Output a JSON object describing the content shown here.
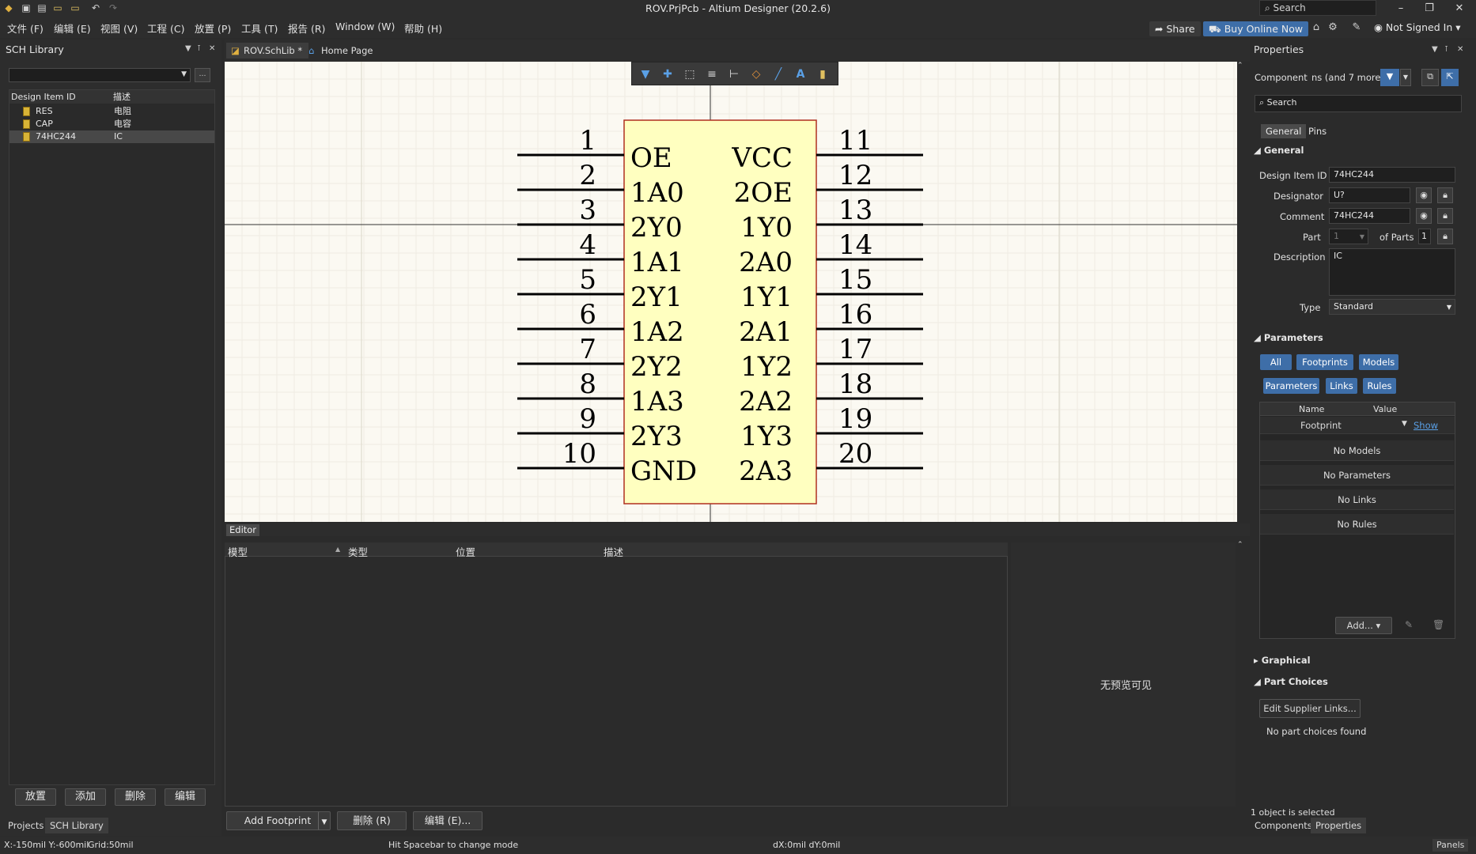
{
  "window": {
    "title": "ROV.PrjPcb - Altium Designer (20.2.6)",
    "search_placeholder": "Search",
    "share": "Share",
    "buy": "Buy Online Now",
    "user": "Not Signed In"
  },
  "menu": [
    "文件 (F)",
    "编辑 (E)",
    "视图 (V)",
    "工程 (C)",
    "放置 (P)",
    "工具 (T)",
    "报告 (R)",
    "Window (W)",
    "帮助 (H)"
  ],
  "left_panel": {
    "title": "SCH Library",
    "columns": [
      "Design Item ID",
      "描述"
    ],
    "rows": [
      {
        "id": "RES",
        "desc": "电阻"
      },
      {
        "id": "CAP",
        "desc": "电容"
      },
      {
        "id": "74HC244",
        "desc": "IC"
      }
    ],
    "buttons": [
      "放置",
      "添加",
      "删除",
      "编辑"
    ],
    "tabs": [
      "Projects",
      "SCH Library"
    ]
  },
  "doc_tabs": [
    "ROV.SchLib *",
    "Home Page"
  ],
  "component": {
    "left_pins": [
      {
        "num": "1",
        "name": "OE"
      },
      {
        "num": "2",
        "name": "1A0"
      },
      {
        "num": "3",
        "name": "2Y0"
      },
      {
        "num": "4",
        "name": "1A1"
      },
      {
        "num": "5",
        "name": "2Y1"
      },
      {
        "num": "6",
        "name": "1A2"
      },
      {
        "num": "7",
        "name": "2Y2"
      },
      {
        "num": "8",
        "name": "1A3"
      },
      {
        "num": "9",
        "name": "2Y3"
      },
      {
        "num": "10",
        "name": "GND"
      }
    ],
    "right_pins": [
      {
        "num": "11",
        "name": "VCC"
      },
      {
        "num": "12",
        "name": "2OE"
      },
      {
        "num": "13",
        "name": "1Y0"
      },
      {
        "num": "14",
        "name": "2A0"
      },
      {
        "num": "15",
        "name": "1Y1"
      },
      {
        "num": "16",
        "name": "2A1"
      },
      {
        "num": "17",
        "name": "1Y2"
      },
      {
        "num": "18",
        "name": "2A2"
      },
      {
        "num": "19",
        "name": "1Y3"
      },
      {
        "num": "20",
        "name": "2A3"
      }
    ]
  },
  "editor": {
    "tab": "Editor",
    "columns": [
      "模型",
      "类型",
      "位置",
      "描述"
    ],
    "preview_text": "无预览可见",
    "buttons": {
      "add_footprint": "Add Footprint",
      "delete": "删除 (R)",
      "edit": "编辑 (E)..."
    }
  },
  "properties": {
    "title": "Properties",
    "component_label": "Component",
    "component_filter": "ns (and 7 more)",
    "search_placeholder": "Search",
    "tabs": [
      "General",
      "Pins"
    ],
    "general_header": "General",
    "design_item_id_label": "Design Item ID",
    "design_item_id": "74HC244",
    "designator_label": "Designator",
    "designator": "U?",
    "comment_label": "Comment",
    "comment": "74HC244",
    "part_label": "Part",
    "part_value": "1",
    "of_parts_label": "of Parts",
    "of_parts_value": "1",
    "description_label": "Description",
    "description": "IC",
    "type_label": "Type",
    "type": "Standard",
    "parameters_header": "Parameters",
    "param_filters_row1": [
      "All",
      "Footprints",
      "Models"
    ],
    "param_filters_row2": [
      "Parameters",
      "Links",
      "Rules"
    ],
    "param_columns": [
      "Name",
      "Value"
    ],
    "footprint_name": "Footprint",
    "footprint_show": "Show",
    "empty_rows": [
      "No Models",
      "No Parameters",
      "No Links",
      "No Rules"
    ],
    "add_button": "Add...",
    "graphical_header": "Graphical",
    "part_choices_header": "Part Choices",
    "edit_supplier": "Edit Supplier Links...",
    "no_part_choices": "No part choices found",
    "selection_status": "1 object is selected",
    "bottom_tabs": [
      "Components",
      "Properties"
    ]
  },
  "status": {
    "coords": "X:-150mil Y:-600mil",
    "grid": "Grid:50mil",
    "hint": "Hit Spacebar to change mode",
    "delta": "dX:0mil dY:0mil",
    "panels": "Panels"
  },
  "colors": {
    "accent": "#3e6ea8",
    "symbol_fill": "#ffffc0",
    "symbol_border": "#b03020",
    "canvas": "#fbf9f2"
  }
}
